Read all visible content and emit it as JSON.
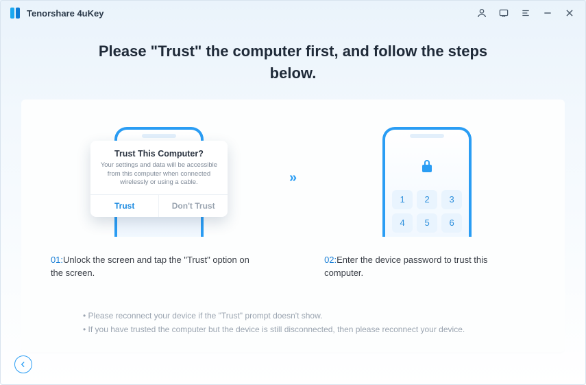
{
  "app_title": "Tenorshare 4uKey",
  "titlebar_icons": {
    "account": "account-icon",
    "feedback": "feedback-icon",
    "menu": "menu-icon",
    "minimize": "minimize-icon",
    "close": "close-icon"
  },
  "heading_line1": "Please \"Trust\" the computer first, and follow the steps",
  "heading_line2": "below.",
  "step1": {
    "num": "01:",
    "text": "Unlock the screen and tap the \"Trust\" option on the screen.",
    "dialog": {
      "title": "Trust This Computer?",
      "message": "Your settings and data will be accessible from this computer when connected wirelessly or using a cable.",
      "trust_label": "Trust",
      "dont_label": "Don't Trust"
    }
  },
  "arrow_glyph": "»",
  "step2": {
    "num": "02:",
    "text": "Enter the device password to trust this computer.",
    "keys": [
      "1",
      "2",
      "3",
      "4",
      "5",
      "6"
    ]
  },
  "bullets": [
    "Please reconnect your device if the \"Trust\" prompt doesn't show.",
    "If you have trusted the computer but the device is still disconnected, then please reconnect your device."
  ],
  "back_label": "Back"
}
